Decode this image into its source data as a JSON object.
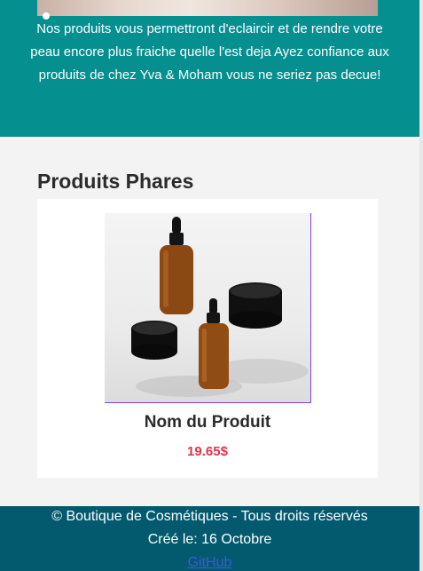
{
  "hero": {
    "description": "Nos produits vous permettront d'eclaircir et de rendre votre peau encore plus fraiche quelle l'est deja Ayez confiance aux produits de chez Yva & Moham vous ne seriez pas decue!"
  },
  "featured": {
    "title": "Produits Phares",
    "products": [
      {
        "name": "Nom du Produit",
        "price": "19.65$",
        "image_icon": "cosmetic-bottles-image"
      }
    ]
  },
  "footer": {
    "copyright": "© Boutique de Cosmétiques - Tous droits réservés",
    "created": "Créé le: 16 Octobre",
    "github_link": "GitHub"
  },
  "colors": {
    "hero_bg": "#058f8f",
    "footer_bg": "#035a6e",
    "price": "#e0344a",
    "link": "#3b5bd9"
  }
}
